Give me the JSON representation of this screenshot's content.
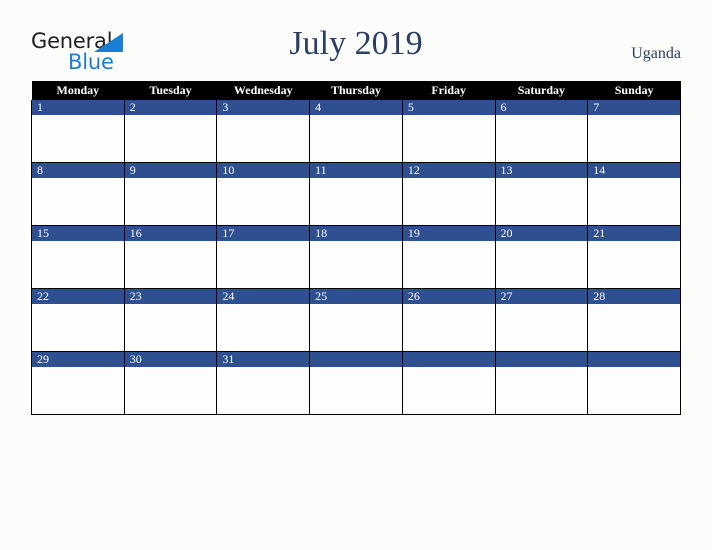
{
  "brand": {
    "name_part1": "General",
    "name_part2": "Blue",
    "triangle_color": "#1a7fd4",
    "text_color": "#231f20"
  },
  "header": {
    "title": "July 2019",
    "country": "Uganda",
    "title_color": "#2b3f66"
  },
  "calendar": {
    "weekday_headers": [
      "Monday",
      "Tuesday",
      "Wednesday",
      "Thursday",
      "Friday",
      "Saturday",
      "Sunday"
    ],
    "header_bg": "#000000",
    "header_text": "#ffffff",
    "daynum_bg": "#2e5090",
    "daynum_text": "#ffffff",
    "cell_bg": "#fdfdfd",
    "border_color": "#000000",
    "weeks": [
      [
        {
          "day": "1"
        },
        {
          "day": "2"
        },
        {
          "day": "3"
        },
        {
          "day": "4"
        },
        {
          "day": "5"
        },
        {
          "day": "6"
        },
        {
          "day": "7"
        }
      ],
      [
        {
          "day": "8"
        },
        {
          "day": "9"
        },
        {
          "day": "10"
        },
        {
          "day": "11"
        },
        {
          "day": "12"
        },
        {
          "day": "13"
        },
        {
          "day": "14"
        }
      ],
      [
        {
          "day": "15"
        },
        {
          "day": "16"
        },
        {
          "day": "17"
        },
        {
          "day": "18"
        },
        {
          "day": "19"
        },
        {
          "day": "20"
        },
        {
          "day": "21"
        }
      ],
      [
        {
          "day": "22"
        },
        {
          "day": "23"
        },
        {
          "day": "24"
        },
        {
          "day": "25"
        },
        {
          "day": "26"
        },
        {
          "day": "27"
        },
        {
          "day": "28"
        }
      ],
      [
        {
          "day": "29"
        },
        {
          "day": "30"
        },
        {
          "day": "31"
        },
        {
          "day": ""
        },
        {
          "day": ""
        },
        {
          "day": ""
        },
        {
          "day": ""
        }
      ]
    ]
  }
}
